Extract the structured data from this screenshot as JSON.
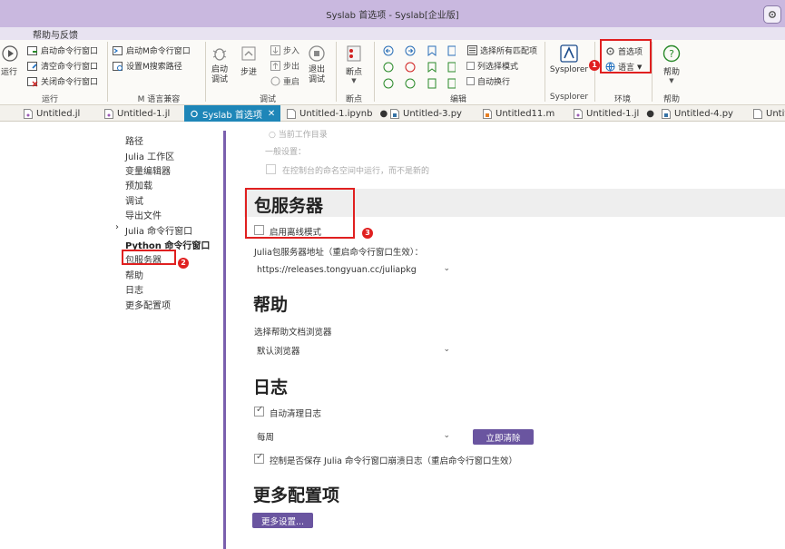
{
  "window": {
    "title": "Syslab 首选项 - Syslab[企业版]"
  },
  "menu": {
    "help_feedback": "帮助与反馈"
  },
  "ribbon": {
    "run": {
      "run_label": "运行",
      "start_cmd": "启动命令行窗口",
      "clear_cmd": "清空命令行窗口",
      "close_cmd": "关闭命令行窗口",
      "group": "运行"
    },
    "m_compat": {
      "start_m": "启动M命令行窗口",
      "set_m_path": "设置M搜索路径",
      "group": "M 语言兼容"
    },
    "debug": {
      "start_debug": "启动\n调试",
      "step": "步进",
      "step_in": "步入",
      "step_out": "步出",
      "restart": "重启",
      "exit_debug": "退出\n调试",
      "group": "调试"
    },
    "breakpoint": {
      "label": "断点",
      "group": "断点"
    },
    "edit": {
      "select_all_matches": "选择所有匹配项",
      "column_select": "列选择模式",
      "auto_wrap": "自动换行",
      "group": "编辑"
    },
    "sysplorer": {
      "label": "Sysplorer",
      "group": "Sysplorer"
    },
    "env": {
      "preferences": "首选项",
      "language": "语言",
      "group": "环境"
    },
    "help": {
      "label": "帮助",
      "group": "帮助"
    }
  },
  "tabs": [
    {
      "label": "Untitled.jl"
    },
    {
      "label": "Untitled-1.jl"
    },
    {
      "label": "Syslab 首选项",
      "active": true
    },
    {
      "label": "Untitled-1.ipynb"
    },
    {
      "label": "Untitled-3.py"
    },
    {
      "label": "Untitled11.m"
    },
    {
      "label": "Untitled-1.jl"
    },
    {
      "label": "Untitled-4.py"
    },
    {
      "label": "Untit"
    }
  ],
  "nav": {
    "items": [
      "路径",
      "Julia 工作区",
      "变量编辑器",
      "预加载",
      "调试",
      "导出文件",
      "Julia 命令行窗口",
      "Python 命令行窗口",
      "包服务器",
      "帮助",
      "日志",
      "更多配置项"
    ]
  },
  "content": {
    "top_faint": "○ 当前工作目录",
    "general_settings": "一般设置：",
    "run_in_unnamed_ns": "在控制台的命名空间中运行，而不是新的",
    "pkg_server": {
      "heading": "包服务器",
      "offline_mode": "启用离线模式",
      "address_label": "Julia包服务器地址（重启命令行窗口生效）：",
      "address_value": "https://releases.tongyuan.cc/juliapkg"
    },
    "help": {
      "heading": "帮助",
      "browser_label": "选择帮助文档浏览器",
      "browser_value": "默认浏览器"
    },
    "log": {
      "heading": "日志",
      "auto_clean": "自动清理日志",
      "interval_value": "每周",
      "clear_now": "立即清除",
      "save_crash_log": "控制是否保存 Julia 命令行窗口崩溃日志（重启命令行窗口生效）"
    },
    "more": {
      "heading": "更多配置项",
      "more_settings": "更多设置..."
    }
  },
  "annotations": {
    "one": "1",
    "two": "2",
    "three": "3"
  },
  "colors": {
    "accent": "#6a55a0",
    "titlebar": "#c9b8df",
    "active_tab": "#1e86b8",
    "highlight": "#e02020"
  }
}
